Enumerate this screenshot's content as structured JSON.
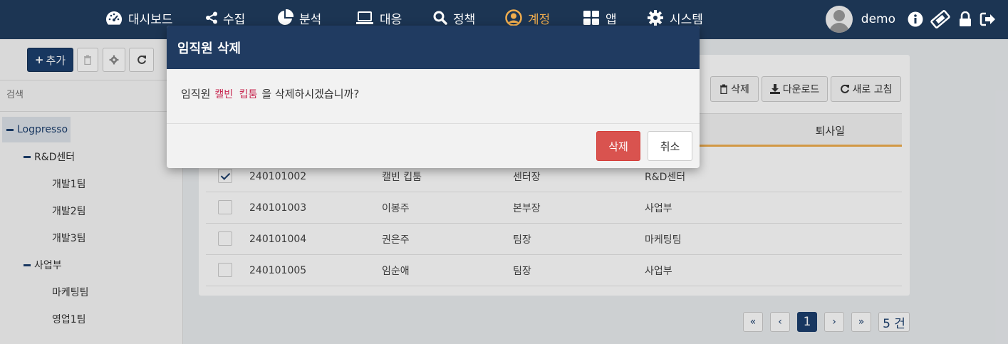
{
  "colors": {
    "nav_bg": "#1c3553",
    "accent": "#f0ad4e",
    "primary": "#1c3f6e",
    "danger": "#d9534f",
    "modal_header": "#203b61"
  },
  "nav": {
    "items": [
      {
        "label": "대시보드",
        "icon": "dashboard-icon"
      },
      {
        "label": "수집",
        "icon": "share-icon"
      },
      {
        "label": "분석",
        "icon": "pie-chart-icon"
      },
      {
        "label": "대응",
        "icon": "laptop-icon"
      },
      {
        "label": "정책",
        "icon": "search-icon"
      },
      {
        "label": "계정",
        "icon": "user-circle-icon",
        "active": true
      },
      {
        "label": "앱",
        "icon": "grid-icon"
      },
      {
        "label": "시스템",
        "icon": "gear-icon"
      }
    ],
    "username": "demo"
  },
  "left": {
    "add_label": "추가",
    "search_placeholder": "검색",
    "tree": [
      {
        "label": "Logpresso",
        "level": 0,
        "expanded": true,
        "selected": true
      },
      {
        "label": "R&D센터",
        "level": 1,
        "expanded": true
      },
      {
        "label": "개발1팀",
        "level": 2
      },
      {
        "label": "개발2팀",
        "level": 2
      },
      {
        "label": "개발3팀",
        "level": 2
      },
      {
        "label": "사업부",
        "level": 1,
        "expanded": true
      },
      {
        "label": "마케팅팀",
        "level": 2
      },
      {
        "label": "영업1팀",
        "level": 2
      }
    ]
  },
  "main": {
    "actions": {
      "delete": "삭제",
      "download": "다운로드",
      "refresh": "새로 고침"
    },
    "header_last": "퇴사일",
    "rows": [
      {
        "id": "240101002",
        "name": "캘빈 킵툼",
        "title": "센터장",
        "dept": "R&D센터",
        "checked": true
      },
      {
        "id": "240101003",
        "name": "이봉주",
        "title": "본부장",
        "dept": "사업부",
        "checked": false
      },
      {
        "id": "240101004",
        "name": "권은주",
        "title": "팀장",
        "dept": "마케팅팀",
        "checked": false
      },
      {
        "id": "240101005",
        "name": "임순애",
        "title": "팀장",
        "dept": "사업부",
        "checked": false
      }
    ],
    "pager": {
      "first": "«",
      "prev": "‹",
      "current": "1",
      "next": "›",
      "last": "»",
      "count": "5 건"
    }
  },
  "modal": {
    "title": "임직원 삭제",
    "msg_prefix": "임직원",
    "msg_name": "캘빈 킵툼",
    "msg_suffix": "을 삭제하시겠습니까?",
    "confirm_label": "삭제",
    "cancel_label": "취소"
  }
}
